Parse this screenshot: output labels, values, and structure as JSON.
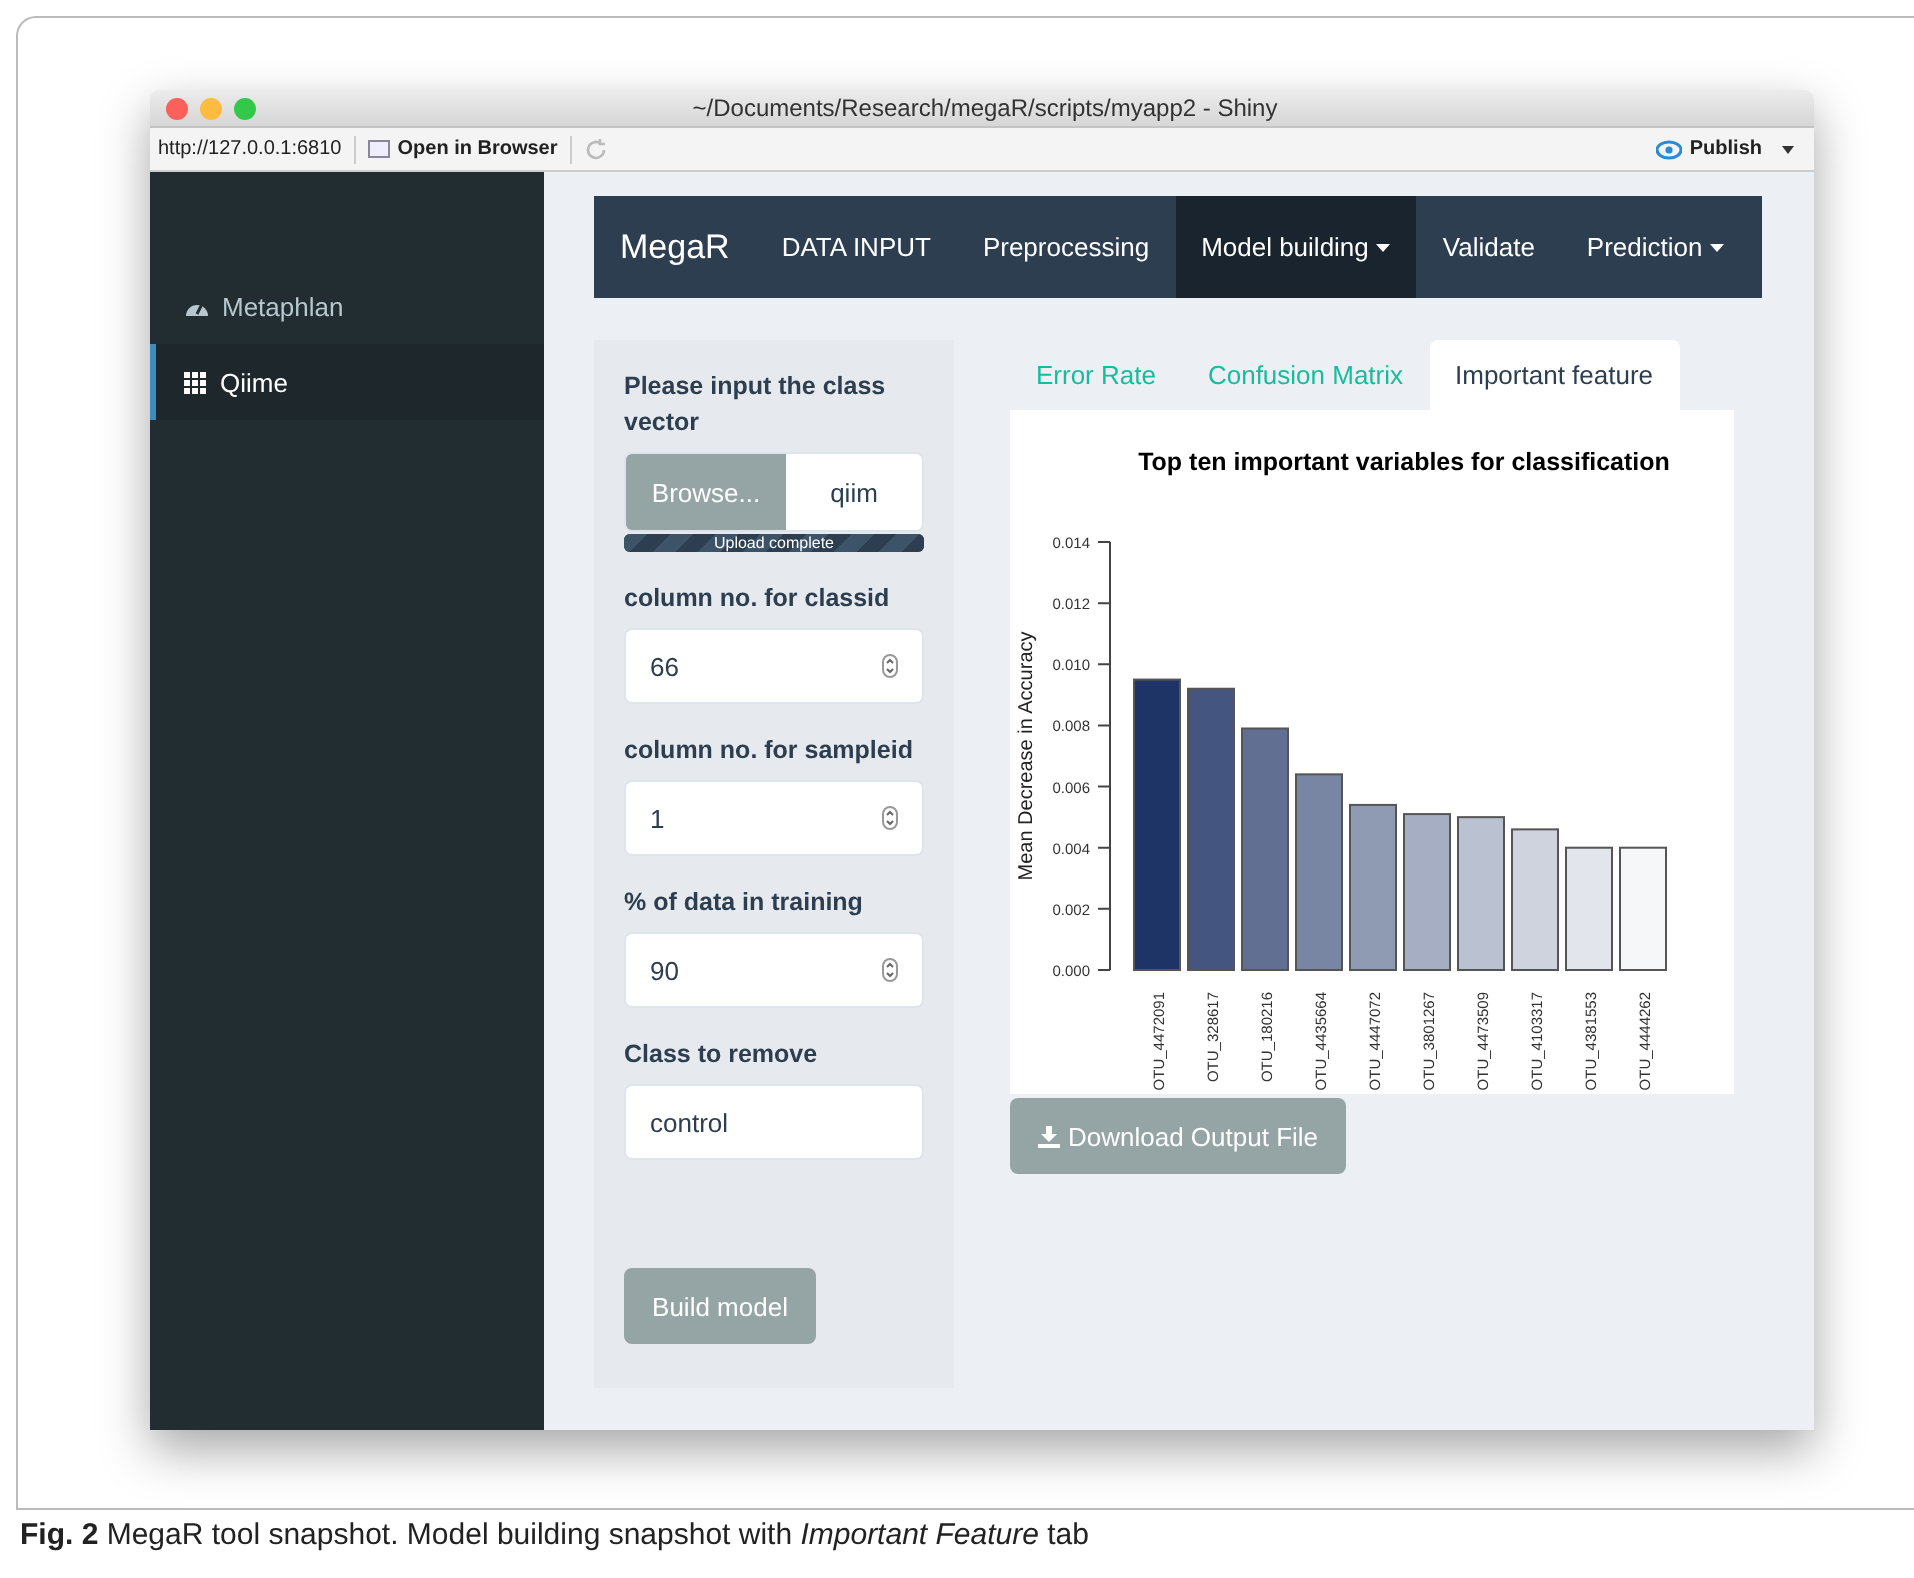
{
  "window": {
    "title": "~/Documents/Research/megaR/scripts/myapp2 - Shiny"
  },
  "toolbar": {
    "url": "http://127.0.0.1:6810",
    "open_in_browser": "Open in Browser",
    "publish": "Publish"
  },
  "sidebar": {
    "items": [
      {
        "label": "Metaphlan",
        "kind": "gauge",
        "selected": false
      },
      {
        "label": "Qiime",
        "kind": "grid",
        "selected": true
      }
    ]
  },
  "navbar": {
    "brand": "MegaR",
    "items": [
      {
        "label": "DATA INPUT",
        "dropdown": false,
        "selected": false
      },
      {
        "label": "Preprocessing",
        "dropdown": false,
        "selected": false
      },
      {
        "label": "Model building",
        "dropdown": true,
        "selected": true
      },
      {
        "label": "Validate",
        "dropdown": false,
        "selected": false
      },
      {
        "label": "Prediction",
        "dropdown": true,
        "selected": false
      }
    ]
  },
  "form": {
    "fields": [
      {
        "kind": "file",
        "label": "Please input the class vector",
        "button": "Browse...",
        "value": "qiim",
        "progress": "Upload complete",
        "level": 1
      },
      {
        "kind": "number",
        "label": "column no. for classid",
        "value": "66"
      },
      {
        "kind": "number",
        "label": "column no. for sampleid",
        "value": "1"
      },
      {
        "kind": "number",
        "label": "% of data in training",
        "value": "90"
      },
      {
        "kind": "text",
        "label": "Class to remove",
        "value": "control"
      }
    ],
    "submit": "Build model"
  },
  "tabs": [
    {
      "label": "Error Rate",
      "selected": false
    },
    {
      "label": "Confusion Matrix",
      "selected": false
    },
    {
      "label": "Important feature",
      "selected": true
    }
  ],
  "chart_data": {
    "type": "bar",
    "title": "Top ten important variables for classification",
    "ylabel": "Mean Decrease in Accuracy",
    "categories": [
      "OTU_4472091",
      "OTU_328617",
      "OTU_180216",
      "OTU_4435664",
      "OTU_4447072",
      "OTU_3801267",
      "OTU_4473509",
      "OTU_4103317",
      "OTU_4381553",
      "OTU_4444262"
    ],
    "series": [
      {
        "values": [
          0.0095,
          0.0092,
          0.0079,
          0.0064,
          0.0054,
          0.0051,
          0.005,
          0.0046,
          0.004,
          0.004
        ]
      }
    ],
    "ylim": [
      0,
      0.014
    ],
    "yticks": [
      {
        "value": 0,
        "label": "0.000"
      },
      {
        "value": 0.002,
        "label": "0.002"
      },
      {
        "value": 0.004,
        "label": "0.004"
      },
      {
        "value": 0.006,
        "label": "0.006"
      },
      {
        "value": 0.008,
        "label": "0.008"
      },
      {
        "value": 0.01,
        "label": "0.010"
      },
      {
        "value": 0.012,
        "label": "0.012"
      },
      {
        "value": 0.014,
        "label": "0.014"
      }
    ]
  },
  "download_button": "Download Output File",
  "caption": "**Fig. 2**  MegaR tool snapshot. Model building snapshot with *Important Feature* tab"
}
